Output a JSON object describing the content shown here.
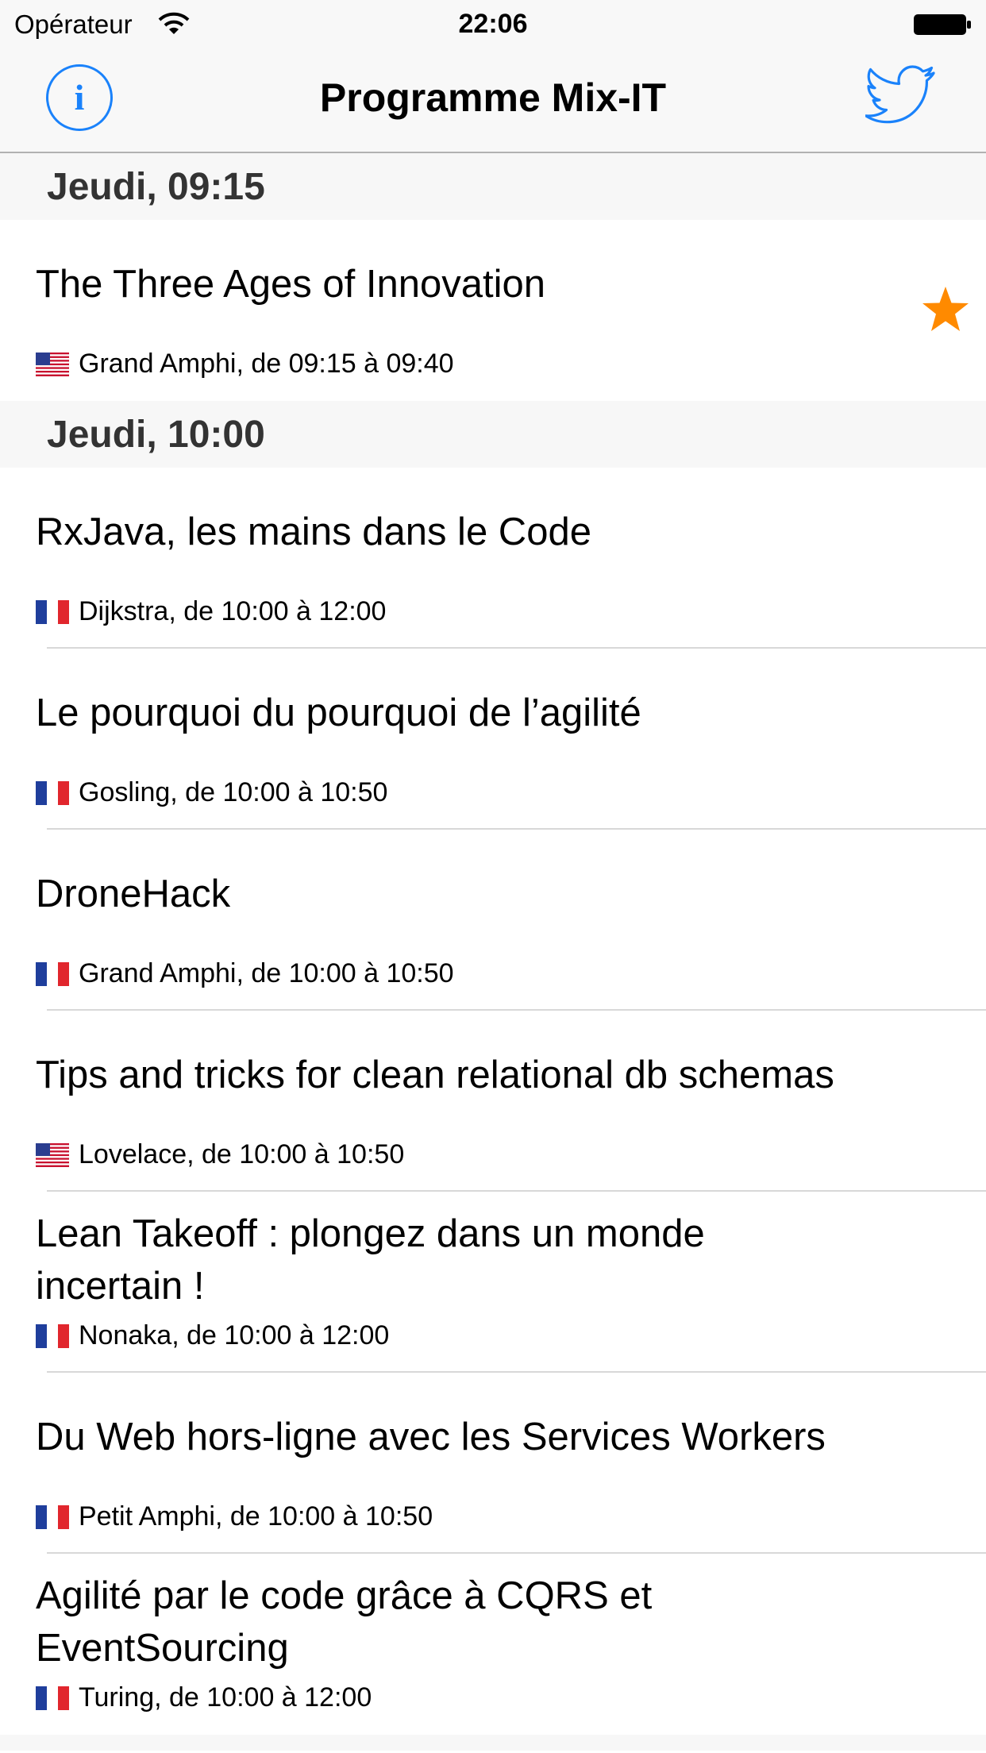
{
  "status_bar": {
    "carrier": "Opérateur",
    "time": "22:06"
  },
  "nav": {
    "title": "Programme Mix-IT",
    "info_glyph": "i"
  },
  "colors": {
    "accent": "#1a82fb",
    "star": "#ff8a00",
    "section_bg": "#f7f7f7"
  },
  "sections": [
    {
      "header": "Jeudi, 09:15",
      "sessions": [
        {
          "title": "The Three Ages of Innovation",
          "flag": "us",
          "meta": "Grand Amphi, de 09:15 à 09:40",
          "favorite": true
        }
      ]
    },
    {
      "header": "Jeudi, 10:00",
      "sessions": [
        {
          "title": "RxJava, les mains dans le Code",
          "flag": "fr",
          "meta": "Dijkstra, de 10:00 à 12:00",
          "favorite": false
        },
        {
          "title": "Le pourquoi du pourquoi de l’agilité",
          "flag": "fr",
          "meta": "Gosling, de 10:00 à 10:50",
          "favorite": false
        },
        {
          "title": "DroneHack",
          "flag": "fr",
          "meta": "Grand Amphi, de 10:00 à 10:50",
          "favorite": false
        },
        {
          "title": "Tips and tricks for clean relational db schemas",
          "flag": "us",
          "meta": "Lovelace, de 10:00 à 10:50",
          "favorite": false
        },
        {
          "title": "Lean Takeoff : plongez dans un monde incertain !",
          "flag": "fr",
          "meta": "Nonaka, de 10:00 à 12:00",
          "favorite": false
        },
        {
          "title": "Du Web hors-ligne avec les Services Workers",
          "flag": "fr",
          "meta": "Petit Amphi, de 10:00 à 10:50",
          "favorite": false
        },
        {
          "title": "Agilité par le code grâce à CQRS et EventSourcing",
          "flag": "fr",
          "meta": "Turing, de 10:00 à 12:00",
          "favorite": false
        }
      ]
    }
  ]
}
